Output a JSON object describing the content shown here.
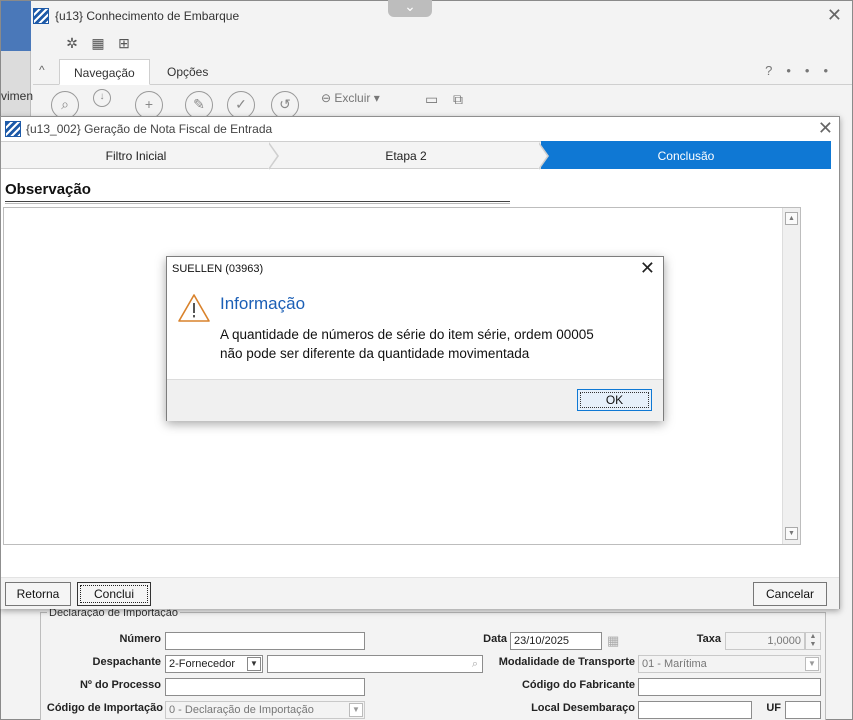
{
  "background_window": {
    "title": "{u13} Conhecimento de Embarque",
    "left_label": "vimen",
    "tabs": [
      "Navegação",
      "Opções"
    ],
    "help": "?",
    "more": "•••",
    "ribbon_excluir": "Excluir"
  },
  "wizard": {
    "title": "{u13_002} Geração de Nota Fiscal de Entrada",
    "steps": [
      "Filtro Inicial",
      "Etapa 2",
      "Conclusão"
    ],
    "active_step": "Conclusão",
    "section_title": "Observação",
    "buttons": {
      "back": "Retorna",
      "finish": "Conclui",
      "cancel": "Cancelar"
    }
  },
  "dialog": {
    "title": "SUELLEN (03963)",
    "heading": "Informação",
    "message_line1": "A quantidade de números de série do item série, ordem 00005",
    "message_line2": "não pode ser diferente da quantidade movimentada",
    "ok_label": "OK"
  },
  "form": {
    "legend": "Declaração de Importação",
    "numero_label": "Número",
    "data_label": "Data",
    "data_value": "23/10/2025",
    "taxa_label": "Taxa",
    "taxa_value": "1,0000",
    "despachante_label": "Despachante",
    "despachante_value": "2-Fornecedor",
    "modalidade_label": "Modalidade de Transporte",
    "modalidade_value": "01 - Marítima",
    "processo_label": "Nº do Processo",
    "fabricante_label": "Código do Fabricante",
    "importacao_label": "Código de Importação",
    "importacao_value": "0 - Declaração de Importação",
    "desembaraco_label": "Local Desembaraço",
    "uf_label": "UF"
  },
  "colors": {
    "accent": "#0f78d4",
    "heading": "#1b5fb6"
  }
}
